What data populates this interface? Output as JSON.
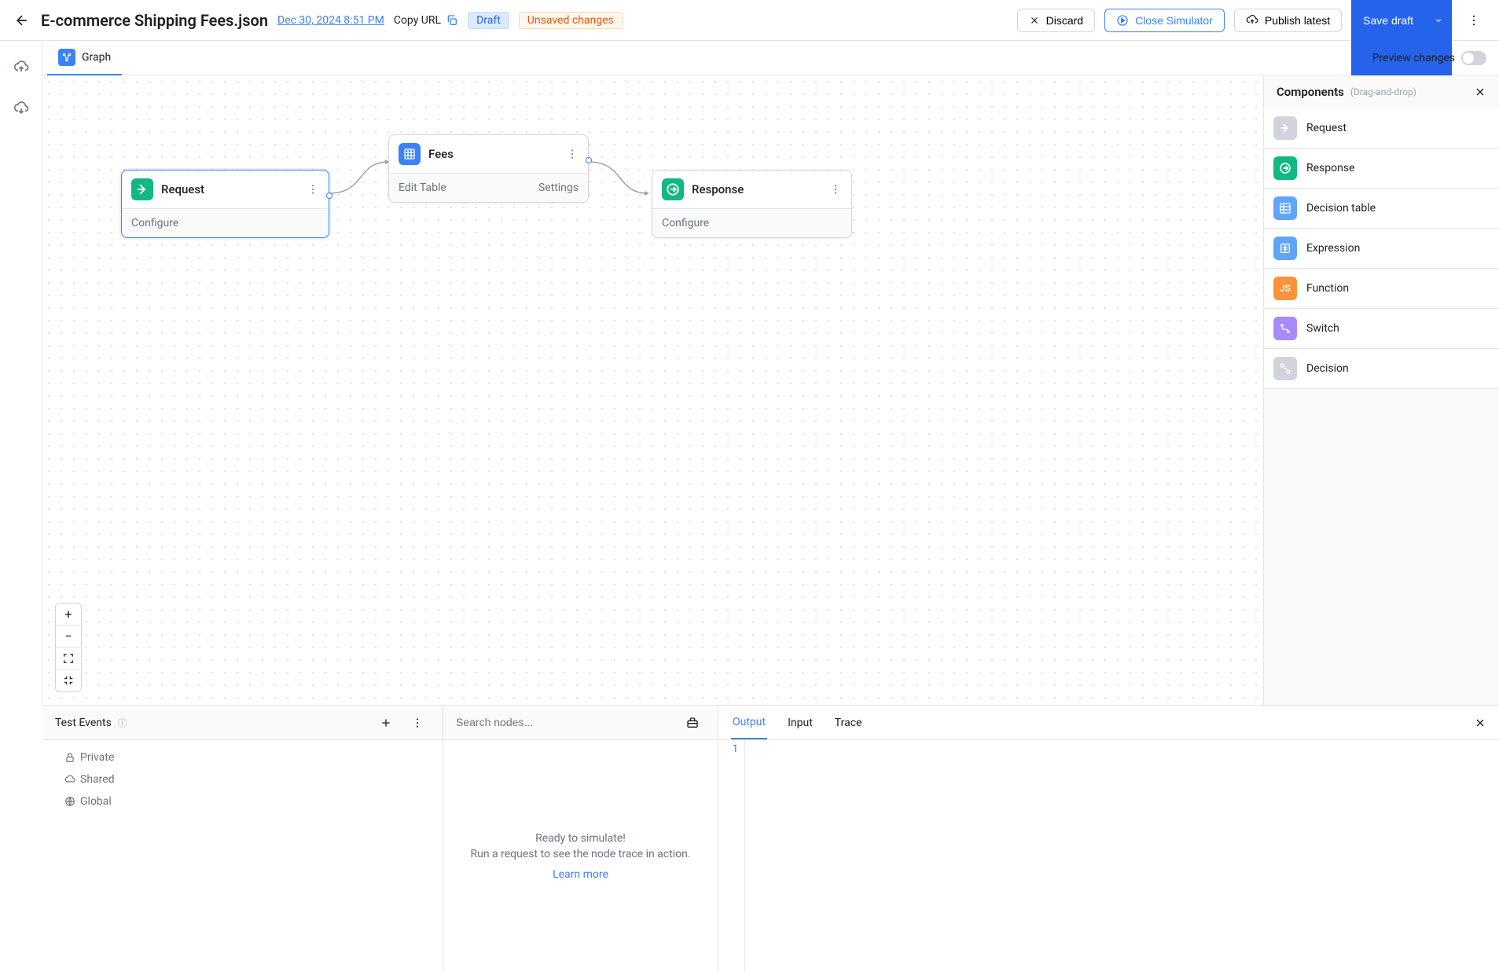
{
  "header": {
    "title": "E-commerce Shipping Fees.json",
    "date": "Dec 30, 2024 8:51 PM",
    "copy_url": "Copy URL",
    "draft_badge": "Draft",
    "unsaved_badge": "Unsaved changes",
    "discard": "Discard",
    "close_simulator": "Close Simulator",
    "publish": "Publish latest",
    "save_draft": "Save draft"
  },
  "tabs": {
    "graph": "Graph",
    "preview_label": "Preview changes"
  },
  "nodes": {
    "request": {
      "title": "Request",
      "action": "Configure"
    },
    "fees": {
      "title": "Fees",
      "action_left": "Edit Table",
      "action_right": "Settings"
    },
    "response": {
      "title": "Response",
      "action": "Configure"
    }
  },
  "components": {
    "title": "Components",
    "hint": "(Drag-and-drop)",
    "items": [
      "Request",
      "Response",
      "Decision table",
      "Expression",
      "Function",
      "Switch",
      "Decision"
    ]
  },
  "bottom": {
    "events": {
      "title": "Test Events",
      "private": "Private",
      "shared": "Shared",
      "global": "Global"
    },
    "search": {
      "placeholder": "Search nodes...",
      "empty_title": "Ready to simulate!",
      "empty_sub": "Run a request to see the node trace in action.",
      "learn_more": "Learn more"
    },
    "output": {
      "tabs": [
        "Output",
        "Input",
        "Trace"
      ],
      "line": "1"
    }
  }
}
